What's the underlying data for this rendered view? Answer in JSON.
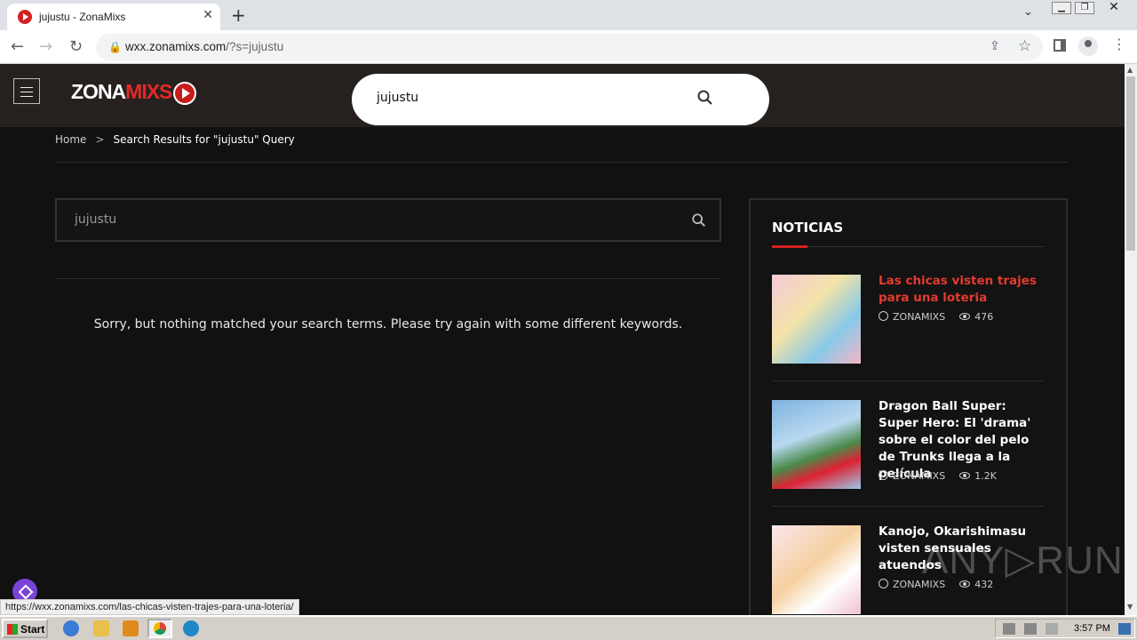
{
  "browser": {
    "tab_title": "jujustu - ZonaMixs",
    "url_host": "wxx.zonamixs.com",
    "url_path": "/?s=jujustu",
    "new_tab": "+",
    "close": "✕"
  },
  "site": {
    "logo_main": "ZONA",
    "logo_accent": "MIXS",
    "header_search_value": "jujustu"
  },
  "breadcrumb": {
    "home": "Home",
    "separator": ">",
    "current": "Search Results for \"jujustu\" Query"
  },
  "search": {
    "value": "jujustu"
  },
  "no_results_message": "Sorry, but nothing matched your search terms. Please try again with some different keywords.",
  "sidebar": {
    "title": "NOTICIAS",
    "posts": [
      {
        "title": "Las chicas visten trajes para una loteria",
        "author": "ZONAMIXS",
        "views": "476"
      },
      {
        "title": "Dragon Ball Super: Super Hero: El 'drama' sobre el color del pelo de Trunks llega a la película",
        "author": "ZONAMIXS",
        "views": "1.2K"
      },
      {
        "title": "Kanojo, Okarishimasu visten sensuales atuendos",
        "author": "ZONAMIXS",
        "views": "432"
      }
    ]
  },
  "status_url": "https://wxx.zonamixs.com/las-chicas-visten-trajes-para-una-loteria/",
  "watermark": "ANY▷RUN",
  "taskbar": {
    "start": "Start",
    "clock": "3:57 PM"
  },
  "colors": {
    "accent": "#d62020",
    "header_bg": "#26211e",
    "page_bg": "#111111"
  }
}
